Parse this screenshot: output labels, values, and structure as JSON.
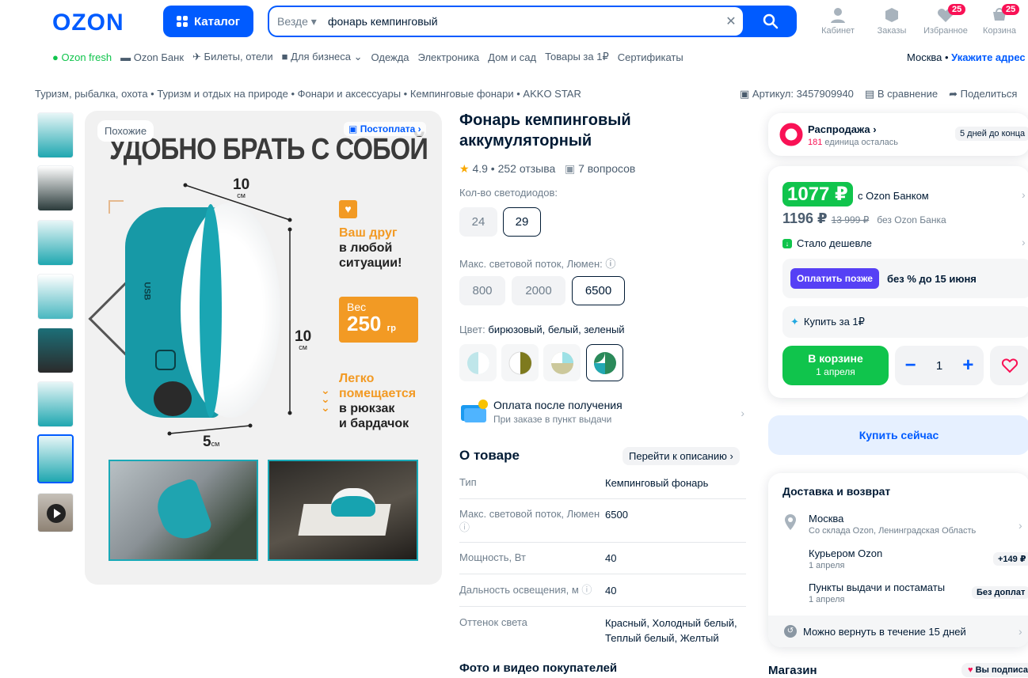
{
  "header": {
    "logo": "OZON",
    "catalog": "Каталог",
    "search_scope": "Везде",
    "search_query": "фонарь кемпинговый",
    "icons": [
      {
        "name": "profile-icon",
        "label": "Кабинет",
        "badge": ""
      },
      {
        "name": "orders-icon",
        "label": "Заказы",
        "badge": ""
      },
      {
        "name": "favorites-icon",
        "label": "Избранное",
        "badge": "25"
      },
      {
        "name": "cart-icon",
        "label": "Корзина",
        "badge": "25"
      }
    ]
  },
  "nav": {
    "items": [
      "Ozon fresh",
      "Ozon Банк",
      "Билеты, отели",
      "Для бизнеса",
      "Одежда",
      "Электроника",
      "Дом и сад",
      "Товары за 1₽",
      "Сертификаты"
    ],
    "city": "Москва",
    "address": "Укажите адрес"
  },
  "breadcrumbs": "Туризм, рыбалка, охота • Туризм и отдых на природе • Фонари и аксессуары • Кемпинговые фонари • AKKO STAR",
  "actions": {
    "sku": "Артикул: 3457909940",
    "compare": "В сравнение",
    "share": "Поделиться"
  },
  "gallery": {
    "similar": "Похожие",
    "postpay": "Постоплата",
    "hero_title": "УДОБНО БРАТЬ С СОБОЙ",
    "dim_top": "10",
    "dim_right": "10",
    "dim_bottom": "5",
    "dim_unit": "см",
    "feat1_a": "Ваш друг",
    "feat1_b": "в любой",
    "feat1_c": "ситуации!",
    "weight_label": "Вес",
    "weight_value": "250",
    "weight_unit": "гр",
    "feat3_a": "Легко",
    "feat3_b": "помещается",
    "feat3_c": "в рюкзак",
    "feat3_d": "и бардачок",
    "usb": "USB"
  },
  "product": {
    "title": "Фонарь кемпинговый аккумуляторный",
    "rating": "4.9 • 252 отзыва",
    "questions": "7 вопросов",
    "leds_label": "Кол-во светодиодов:",
    "leds": [
      "24",
      "29"
    ],
    "flux_label": "Макс. световой поток, Люмен:",
    "flux": [
      "800",
      "2000",
      "6500"
    ],
    "color_label": "Цвет:",
    "color_value": "бирюзовый, белый, зеленый",
    "payment_title": "Оплата после получения",
    "payment_sub": "При заказе в пункт выдачи",
    "about": "О товаре",
    "goto_desc": "Перейти к описанию",
    "specs": [
      {
        "k": "Тип",
        "v": "Кемпинговый фонарь"
      },
      {
        "k": "Макс. световой поток, Люмен",
        "v": "6500"
      },
      {
        "k": "Мощность, Вт",
        "v": "40"
      },
      {
        "k": "Дальность освещения, м",
        "v": "40"
      },
      {
        "k": "Оттенок света",
        "v": "Красный, Холодный белый, Теплый белый, Желтый"
      }
    ],
    "photos_title": "Фото и видео покупателей"
  },
  "buybox": {
    "sale_title": "Распродажа",
    "sale_count": "181",
    "sale_sub": "единица осталась",
    "sale_days": "5 дней до конца",
    "price_card": "1077 ₽",
    "price_card_label": "с Ozon Банком",
    "price": "1196 ₽",
    "price_old": "13 999 ₽",
    "price_label": "без Ozon Банка",
    "cheaper": "Стало дешевле",
    "later_btn": "Оплатить позже",
    "later_text": "без % до 15 июня",
    "buy_for_1": "Купить за 1₽",
    "in_cart": "В корзине",
    "in_cart_date": "1 апреля",
    "qty": "1",
    "buy_now": "Купить сейчас"
  },
  "delivery": {
    "title": "Доставка и возврат",
    "city": "Москва",
    "warehouse": "Со склада Ozon, Ленинградская Область",
    "courier": "Курьером Ozon",
    "courier_date": "1 апреля",
    "courier_price": "+149 ₽",
    "pickup": "Пункты выдачи и постаматы",
    "pickup_date": "1 апреля",
    "pickup_price": "Без доплат",
    "return": "Можно вернуть в течение 15 дней"
  },
  "shop": {
    "title": "Магазин",
    "subscribed": "Вы подписаны"
  },
  "colors": {
    "brand": "#005bff",
    "green": "#10c44c",
    "pink": "#f91155",
    "orange": "#f29a24",
    "teal": "#1799a6"
  }
}
